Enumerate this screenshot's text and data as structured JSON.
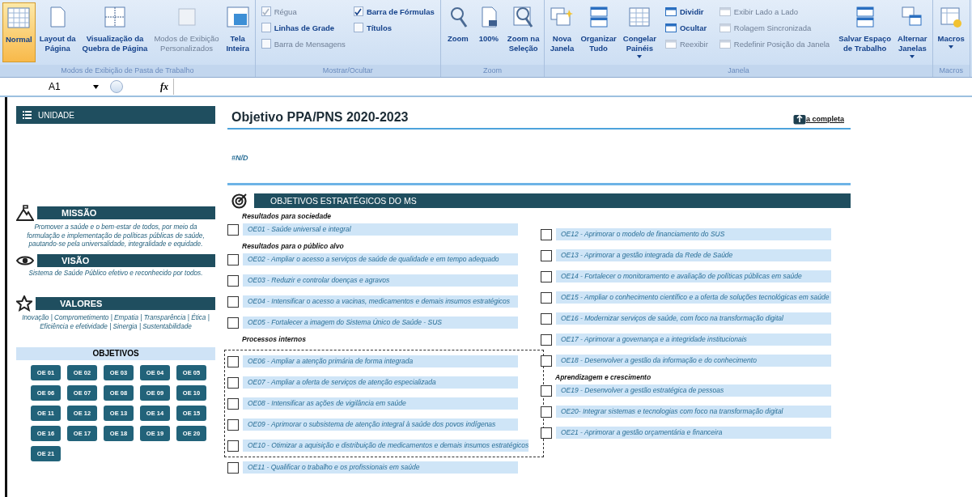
{
  "ribbon": {
    "groups": [
      {
        "label": "Modos de Exibição de Pasta de Trabalho",
        "items": [
          {
            "kind": "large",
            "lines": [
              "Normal"
            ],
            "selected": true,
            "disabled": false,
            "dropdown": false
          },
          {
            "kind": "large",
            "lines": [
              "Layout da",
              "Página"
            ],
            "selected": false,
            "disabled": false,
            "dropdown": false
          },
          {
            "kind": "large",
            "lines": [
              "Visualização da",
              "Quebra de Página"
            ],
            "selected": false,
            "disabled": false,
            "dropdown": false
          },
          {
            "kind": "large",
            "lines": [
              "Modos de Exibição",
              "Personalizados"
            ],
            "selected": false,
            "disabled": true,
            "dropdown": false
          },
          {
            "kind": "large",
            "lines": [
              "Tela",
              "Inteira"
            ],
            "selected": false,
            "disabled": false,
            "dropdown": false
          }
        ]
      },
      {
        "label": "Mostrar/Ocultar",
        "items": [
          {
            "kind": "stack",
            "items": [
              {
                "kind": "checkbox",
                "label": "Régua",
                "checked": true,
                "disabled": true
              },
              {
                "kind": "checkbox",
                "label": "Linhas de Grade",
                "checked": false,
                "disabled": false
              },
              {
                "kind": "checkbox",
                "label": "Barra de Mensagens",
                "checked": false,
                "disabled": true
              },
              {
                "kind": "checkbox",
                "label": "Barra de Fórmulas",
                "checked": true,
                "disabled": false
              },
              {
                "kind": "checkbox",
                "label": "Títulos",
                "checked": false,
                "disabled": false
              }
            ]
          }
        ]
      },
      {
        "label": "Zoom",
        "items": [
          {
            "kind": "large",
            "lines": [
              "Zoom"
            ],
            "selected": false,
            "disabled": false,
            "dropdown": false
          },
          {
            "kind": "large",
            "lines": [
              "100%"
            ],
            "selected": false,
            "disabled": false,
            "dropdown": false
          },
          {
            "kind": "large",
            "lines": [
              "Zoom na",
              "Seleção"
            ],
            "selected": false,
            "disabled": false,
            "dropdown": false
          }
        ]
      },
      {
        "label": "Janela",
        "items": [
          {
            "kind": "large",
            "lines": [
              "Nova",
              "Janela"
            ],
            "selected": false,
            "disabled": false,
            "dropdown": false
          },
          {
            "kind": "large",
            "lines": [
              "Organizar",
              "Tudo"
            ],
            "selected": false,
            "disabled": false,
            "dropdown": false
          },
          {
            "kind": "large",
            "lines": [
              "Congelar",
              "Painéis"
            ],
            "selected": false,
            "disabled": false,
            "dropdown": true
          },
          {
            "kind": "stack",
            "items": [
              {
                "kind": "small",
                "label": "Dividir",
                "disabled": false
              },
              {
                "kind": "small",
                "label": "Ocultar",
                "disabled": false
              },
              {
                "kind": "small",
                "label": "Reexibir",
                "disabled": true
              }
            ]
          },
          {
            "kind": "stack",
            "items": [
              {
                "kind": "small",
                "label": "Exibir Lado a Lado",
                "disabled": true
              },
              {
                "kind": "small",
                "label": "Rolagem Sincronizada",
                "disabled": true
              },
              {
                "kind": "small",
                "label": "Redefinir Posição da Janela",
                "disabled": true
              }
            ]
          },
          {
            "kind": "large",
            "lines": [
              "Salvar Espaço",
              "de Trabalho"
            ],
            "selected": false,
            "disabled": false,
            "dropdown": false
          },
          {
            "kind": "large",
            "lines": [
              "Alternar",
              "Janelas"
            ],
            "selected": false,
            "disabled": false,
            "dropdown": true
          }
        ]
      },
      {
        "label": "Macros",
        "items": [
          {
            "kind": "large",
            "lines": [
              "Macros"
            ],
            "selected": false,
            "disabled": false,
            "dropdown": true
          }
        ]
      }
    ]
  },
  "formula_bar": {
    "name_box": "A1",
    "fx": "fx"
  },
  "panel": {
    "unidade": "UNIDADE",
    "blocks": [
      {
        "title": "MISSÃO",
        "text": "Promover a saúde e o bem-estar de todos, por meio da formulação e implementação de políticas públicas de saúde, pautando-se pela universalidade, integralidade e equidade."
      },
      {
        "title": "VISÃO",
        "text": "Sistema de Saúde Público efetivo e reconhecido por todos."
      },
      {
        "title": "VALORES",
        "text": "Inovação | Comprometimento | Empatia | Transparência | Ética | Eficiência e efetividade | Sinergia | Sustentabilidade"
      }
    ],
    "objetivos_title": "OBJETIVOS",
    "objetivos": [
      "OE 01",
      "OE 02",
      "OE 03",
      "OE 04",
      "OE 05",
      "OE 06",
      "OE 07",
      "OE 08",
      "OE 09",
      "OE 10",
      "OE 11",
      "OE 12",
      "OE 13",
      "OE 14",
      "OE 15",
      "OE 16",
      "OE 17",
      "OE 18",
      "OE 19",
      "OE 20",
      "OE 21"
    ]
  },
  "main": {
    "title": "Objetivo PPA/PNS 2020-2023",
    "fullscreen_link": "a completa",
    "value": "#N/D",
    "section_title": "OBJETIVOS ESTRATÉGICOS DO MS",
    "columns": [
      {
        "sections": [
          {
            "heading": "Resultados para sociedade",
            "items": [
              {
                "text": "OE01 - Saúde universal e integral",
                "checked": false,
                "in_marquee": false
              }
            ]
          },
          {
            "heading": "Resultados para o público alvo",
            "items": [
              {
                "text": "OE02 - Ampliar o acesso a serviços de saúde de qualidade e em tempo adequado",
                "checked": false,
                "in_marquee": false
              },
              {
                "text": "OE03 - Reduzir e controlar doenças e agravos",
                "checked": false,
                "in_marquee": false
              },
              {
                "text": "OE04 - Intensificar o acesso a vacinas, medicamentos e demais insumos estratégicos",
                "checked": false,
                "in_marquee": false
              },
              {
                "text": "OE05 - Fortalecer a imagem do Sistema Único de Saúde - SUS",
                "checked": false,
                "in_marquee": false
              }
            ]
          },
          {
            "heading": "Processos internos",
            "items": [
              {
                "text": "OE06 - Ampliar a atenção primária de forma integrada",
                "checked": false,
                "in_marquee": true
              },
              {
                "text": "OE07 - Ampliar a oferta de serviços de atenção especializada",
                "checked": false,
                "in_marquee": true
              },
              {
                "text": "OE08 - Intensificar as ações de vigilância em saúde",
                "checked": false,
                "in_marquee": true
              },
              {
                "text": "OE09 - Aprimorar o subsistema de atenção integral à saúde dos povos indígenas",
                "checked": false,
                "in_marquee": true
              },
              {
                "text": "OE10 - Otimizar a aquisição e distribuição de medicamentos e demais insumos estratégicos",
                "checked": false,
                "in_marquee": true
              },
              {
                "text": "OE11 - Qualificar o trabalho e os profissionais em saúde",
                "checked": false,
                "in_marquee": false
              }
            ]
          }
        ]
      },
      {
        "sections": [
          {
            "items": [
              {
                "text": "OE12 - Aprimorar o modelo de financiamento do SUS",
                "checked": false,
                "in_marquee": false
              },
              {
                "text": "OE13 - Aprimorar a gestão integrada da Rede de Saúde",
                "checked": false,
                "in_marquee": false
              },
              {
                "text": "OE14 - Fortalecer o monitoramento e avaliação de políticas públicas em saúde",
                "checked": false,
                "in_marquee": false
              },
              {
                "text": "OE15 - Ampliar o conhecimento científico e a oferta de soluções tecnológicas em saúde",
                "checked": false,
                "in_marquee": false
              },
              {
                "text": "OE16 - Modernizar serviços de saúde, com foco na transformação digital",
                "checked": false,
                "in_marquee": false
              },
              {
                "text": "OE17 - Aprimorar a governança e a integridade institucionais",
                "checked": false,
                "in_marquee": false
              },
              {
                "text": "OE18 - Desenvolver a gestão da informação e do conhecimento",
                "checked": false,
                "in_marquee": false
              }
            ]
          },
          {
            "heading": "Aprendizagem e crescimento",
            "items": [
              {
                "text": "OE19 - Desenvolver a gestão estratégica de pessoas",
                "checked": false,
                "in_marquee": false
              },
              {
                "text": "OE20- Integrar sistemas e tecnologias com foco na transformação digital",
                "checked": false,
                "in_marquee": false
              },
              {
                "text": "OE21 - Aprimorar a gestão orçamentária e financeira",
                "checked": false,
                "in_marquee": false
              }
            ]
          }
        ]
      }
    ]
  }
}
